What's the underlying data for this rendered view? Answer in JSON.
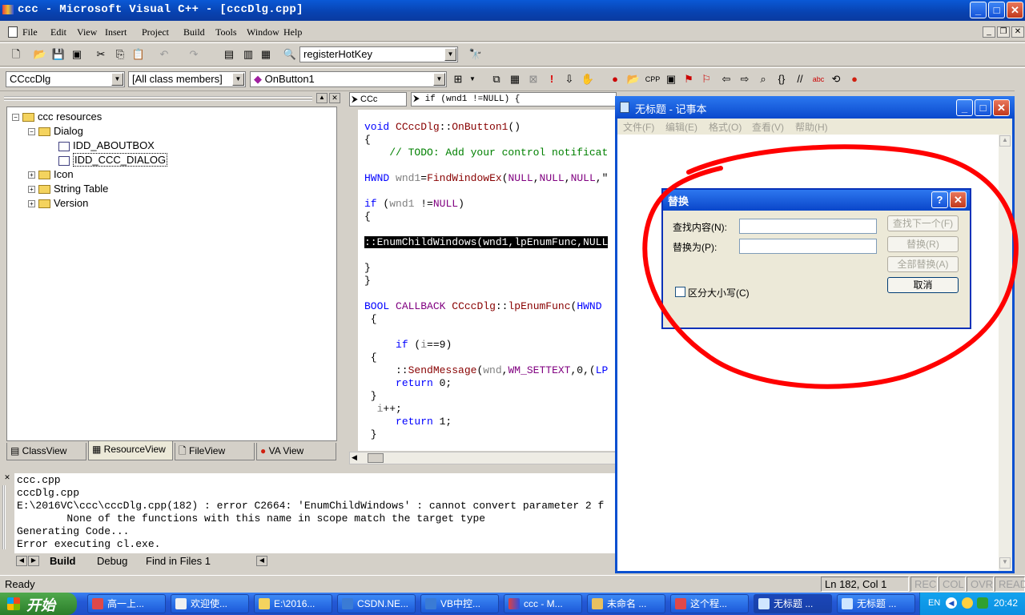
{
  "vc_window": {
    "title": "ccc - Microsoft Visual C++ - [cccDlg.cpp]",
    "menu": [
      "File",
      "Edit",
      "View",
      "Insert",
      "Project",
      "Build",
      "Tools",
      "Window",
      "Help"
    ],
    "find_combo": "registerHotKey",
    "class_combo": "CCccDlg",
    "filter_combo": "[All class members]",
    "member_combo": "OnButton1",
    "va_scope_combo": "CCc",
    "va_context": "if (wnd1 !=NULL) {"
  },
  "workspace": {
    "tree": [
      {
        "label": "ccc resources",
        "level": 0,
        "kind": "root"
      },
      {
        "label": "Dialog",
        "level": 1,
        "kind": "folder"
      },
      {
        "label": "IDD_ABOUTBOX",
        "level": 2,
        "kind": "resource"
      },
      {
        "label": "IDD_CCC_DIALOG",
        "level": 2,
        "kind": "resource",
        "selected": true
      },
      {
        "label": "Icon",
        "level": 1,
        "kind": "folder"
      },
      {
        "label": "String Table",
        "level": 1,
        "kind": "folder"
      },
      {
        "label": "Version",
        "level": 1,
        "kind": "folder"
      }
    ],
    "tabs": [
      "ClassView",
      "ResourceView",
      "FileView",
      "VA View"
    ],
    "active_tab": "ResourceView"
  },
  "code_lines": [
    "void CCccDlg::OnButton1()",
    "{",
    "    // TODO: Add your control notificat",
    "",
    "HWND wnd1=FindWindowEx(NULL,NULL,NULL,\"",
    "",
    "if (wnd1 !=NULL)",
    "{",
    "",
    "::EnumChildWindows(wnd1,lpEnumFunc,NULL",
    "",
    "}",
    "}",
    "",
    "BOOL CALLBACK CCccDlg::lpEnumFunc(HWND",
    " {",
    "",
    "     if (i==9)",
    " {",
    "",
    "     ::SendMessage(wnd,WM_SETTEXT,0,(LP",
    "     return 0;",
    " }",
    "  i++;",
    "     return 1;",
    " }"
  ],
  "output": {
    "lines": [
      "ccc.cpp",
      "cccDlg.cpp",
      "E:\\2016VC\\ccc\\cccDlg.cpp(182) : error C2664: 'EnumChildWindows' : cannot convert parameter 2 f",
      "        None of the functions with this name in scope match the target type",
      "Generating Code...",
      "Error executing cl.exe."
    ],
    "tabs": [
      "Build",
      "Debug",
      "Find in Files 1"
    ]
  },
  "notepad": {
    "title": "无标题 - 记事本",
    "menu": [
      "文件(F)",
      "编辑(E)",
      "格式(O)",
      "查看(V)",
      "帮助(H)"
    ]
  },
  "replace_dialog": {
    "title": "替换",
    "find_label": "查找内容(N):",
    "replace_label": "替换为(P):",
    "find_value": "",
    "replace_value": "",
    "btn_find_next": "查找下一个(F)",
    "btn_replace": "替换(R)",
    "btn_replace_all": "全部替换(A)",
    "btn_cancel": "取消",
    "match_case": "区分大小写(C)",
    "help": "?",
    "accent": "#ff0000"
  },
  "status": {
    "ready": "Ready",
    "position": "Ln 182, Col 1",
    "indicators": [
      "REC",
      "COL",
      "OVR",
      "READ"
    ]
  },
  "taskbar": {
    "start": "开始",
    "tasks": [
      "高一上...",
      "欢迎使...",
      "E:\\2016...",
      "CSDN.NE...",
      "VB中控...",
      "ccc - M...",
      "未命名 ...",
      "这个程...",
      "无标题 ...",
      "无标题 ..."
    ],
    "lang": "EN",
    "clock": "20:42"
  }
}
